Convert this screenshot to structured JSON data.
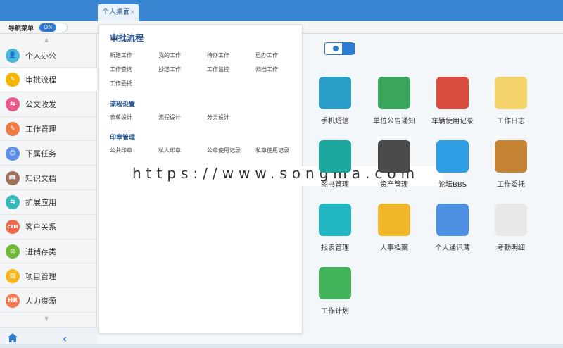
{
  "tabs": [
    {
      "label": "个人桌面",
      "close": "×"
    }
  ],
  "nav_toggle": {
    "label": "导航菜单",
    "state": "ON"
  },
  "sidebar": {
    "items": [
      {
        "label": "个人办公",
        "icon": "person-icon",
        "color": "#4db7d8",
        "glyph": "👤"
      },
      {
        "label": "审批流程",
        "icon": "approval-icon",
        "color": "#f5b400",
        "glyph": "✎"
      },
      {
        "label": "公文收发",
        "icon": "document-icon",
        "color": "#e85a8a",
        "glyph": "⇆"
      },
      {
        "label": "工作管理",
        "icon": "work-icon",
        "color": "#f07a43",
        "glyph": "✎"
      },
      {
        "label": "下属任务",
        "icon": "team-icon",
        "color": "#5f8fe8",
        "glyph": "☺"
      },
      {
        "label": "知识文档",
        "icon": "book-icon",
        "color": "#a06f5a",
        "glyph": "📖"
      },
      {
        "label": "扩展应用",
        "icon": "apps-icon",
        "color": "#37b8b8",
        "glyph": "⇆"
      },
      {
        "label": "客户关系",
        "icon": "crm-icon",
        "color": "#ef6a4d",
        "glyph": "CRM"
      },
      {
        "label": "进销存类",
        "icon": "inventory-icon",
        "color": "#70b935",
        "glyph": "⚖"
      },
      {
        "label": "项目管理",
        "icon": "project-icon",
        "color": "#f6b51c",
        "glyph": "▤"
      },
      {
        "label": "人力资源",
        "icon": "hr-icon",
        "color": "#f47a55",
        "glyph": "HR"
      }
    ]
  },
  "panel": {
    "title": "审批流程",
    "groups": [
      {
        "items": [
          "新建工作",
          "我的工作",
          "待办工作",
          "已办工作",
          "工作查询",
          "抄送工作",
          "工作监控",
          "归档工作",
          "工作委托"
        ]
      },
      {
        "title": "流程设置",
        "items": [
          "表单设计",
          "流程设计",
          "分类设计"
        ]
      },
      {
        "title": "印章管理",
        "items": [
          "公共印章",
          "私人印章",
          "公章使用记录",
          "私章使用记录"
        ]
      }
    ]
  },
  "watermark": "https://www.songma.com",
  "apps": [
    {
      "label": "手机短信",
      "color": "#2a9ec8",
      "icon": "sms-icon"
    },
    {
      "label": "单位公告通知",
      "color": "#3aa55c",
      "icon": "notice-icon"
    },
    {
      "label": "车辆使用记录",
      "color": "#d94d3e",
      "icon": "speedometer-icon"
    },
    {
      "label": "工作日志",
      "color": "#f3d36a",
      "icon": "notes-icon"
    },
    {
      "label": "图书管理",
      "color": "#1aa69d",
      "icon": "library-icon"
    },
    {
      "label": "资产管理",
      "color": "#4b4b4b",
      "icon": "asset-icon"
    },
    {
      "label": "论坛BBS",
      "color": "#2f9de3",
      "icon": "forum-icon"
    },
    {
      "label": "工作委托",
      "color": "#c78334",
      "icon": "delegate-icon"
    },
    {
      "label": "报表管理",
      "color": "#22b5c2",
      "icon": "report-icon"
    },
    {
      "label": "人事档案",
      "color": "#f0b72a",
      "icon": "personnel-icon"
    },
    {
      "label": "个人通讯薄",
      "color": "#4d8fe0",
      "icon": "contacts-icon"
    },
    {
      "label": "考勤明细",
      "color": "#e8e8e8",
      "icon": "attendance-icon"
    },
    {
      "label": "工作计划",
      "color": "#43b35b",
      "icon": "plan-icon"
    }
  ]
}
